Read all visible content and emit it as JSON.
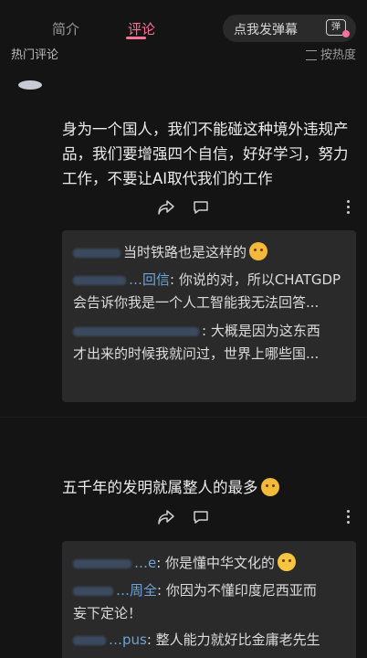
{
  "tabs": [
    "简介",
    "评论"
  ],
  "danmaku": {
    "placeholder": "点我发弹幕",
    "icon_label": "弹"
  },
  "section": {
    "title": "热门评论",
    "sort_label": "按热度"
  },
  "comments": [
    {
      "text_lines": [
        "身为一个国人，我们不能碰这种境外违规产",
        "品，我们要增强四个自信，好好学习，努力",
        "工作，不要让AI取代我们的工作"
      ],
      "replies": [
        {
          "username": "",
          "text": "当时铁路也是这样的"
        },
        {
          "username": "…回信",
          "text": ": 你说的对，所以CHATGDP",
          "text2": "会告诉你我是一个人工智能我无法回答..."
        },
        {
          "username": "",
          "text": ": 大概是因为这东西",
          "text2": "才出来的时候我就问过，世界上哪些国..."
        }
      ]
    },
    {
      "text_lines": [
        "五千年的发明就属整人的最多"
      ],
      "replies": [
        {
          "username": "…e",
          "text": ": 你是懂中华文化的"
        },
        {
          "username": "…周全",
          "text": ": 你因为不懂印度尼西亚而",
          "text2": "妄下定论！"
        },
        {
          "username": "…pus",
          "text": ": 整人能力就好比金庸老先生"
        }
      ]
    }
  ],
  "icons": [
    "share-icon",
    "reply-icon",
    "more-icon",
    "emoji-icon",
    "tv-icon"
  ],
  "colors": {
    "accent": "#fb7299",
    "username": "#6ea3d8",
    "background": "#141414",
    "reply_box": "#2a2a2a"
  }
}
